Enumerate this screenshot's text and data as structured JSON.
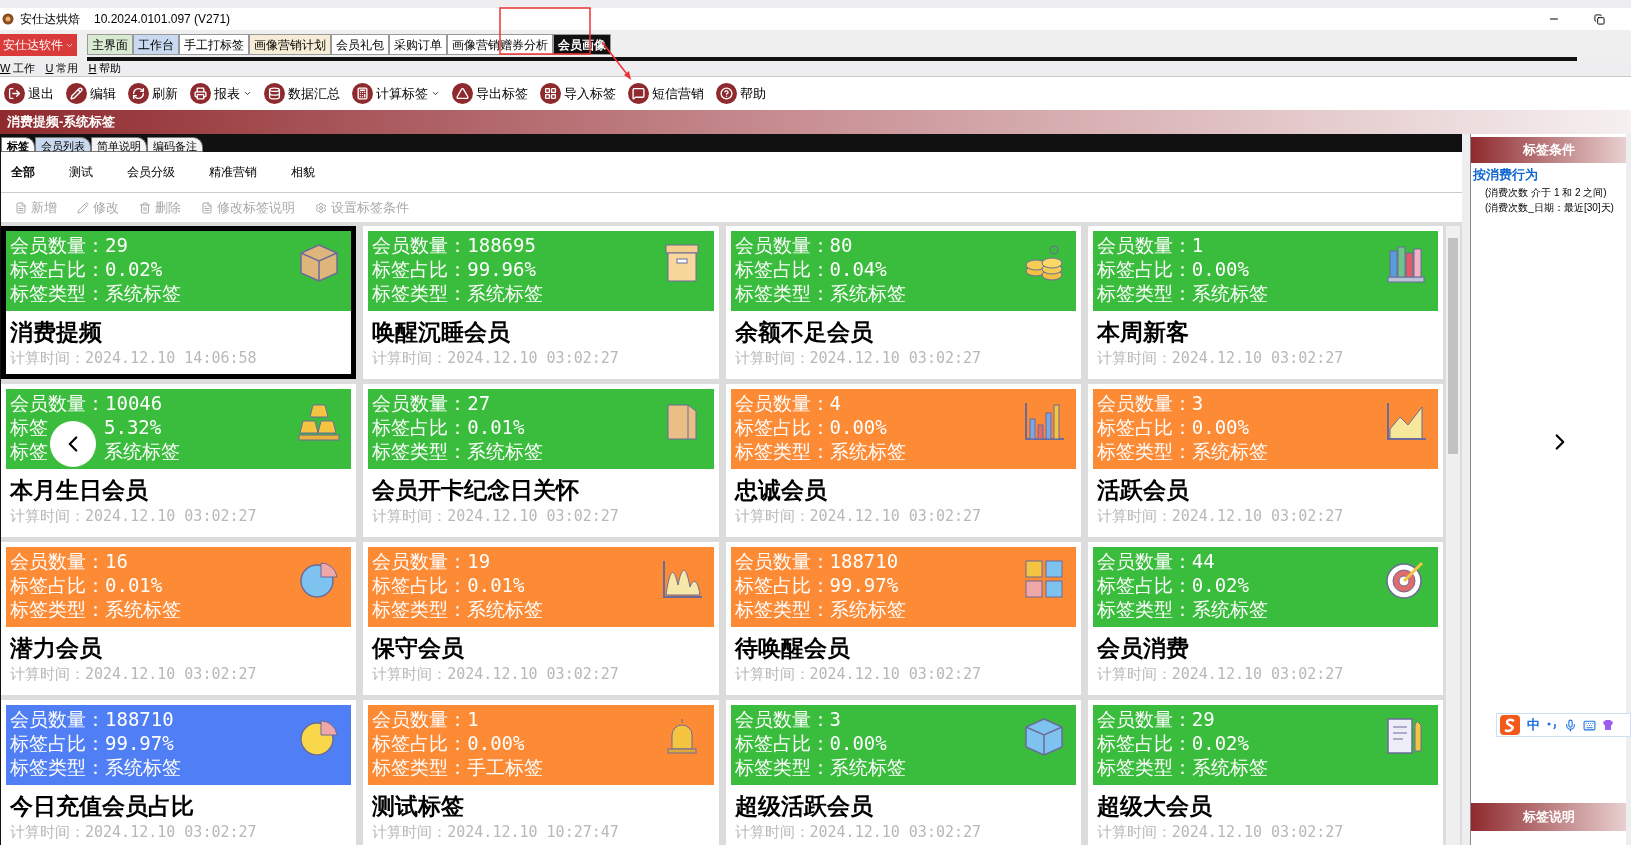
{
  "window": {
    "app_name": "安仕达烘焙",
    "version": "10.2024.0101.097 (V271)"
  },
  "brand_menu": "安仕达软件",
  "module_tabs": [
    {
      "label": "主界面",
      "selected": false,
      "color": "#d9ead3"
    },
    {
      "label": "工作台",
      "selected": false,
      "color": "#c9daf0"
    },
    {
      "label": "手工打标签",
      "selected": false,
      "color": "#ffffff"
    },
    {
      "label": "画像营销计划",
      "selected": false,
      "color": "#f7ecd5"
    },
    {
      "label": "会员礼包",
      "selected": false,
      "color": "#ffffff"
    },
    {
      "label": "采购订单",
      "selected": false,
      "color": "#ffffff"
    },
    {
      "label": "画像营销赠券分析",
      "selected": false,
      "color": "#ffffff"
    },
    {
      "label": "会员画像",
      "selected": true
    }
  ],
  "menu": [
    {
      "key": "W",
      "label": "工作"
    },
    {
      "key": "U",
      "label": "常用"
    },
    {
      "key": "H",
      "label": "帮助"
    }
  ],
  "toolbar": [
    {
      "label": "退出",
      "dropdown": false
    },
    {
      "label": "编辑",
      "dropdown": false
    },
    {
      "label": "刷新",
      "dropdown": false
    },
    {
      "label": "报表",
      "dropdown": true
    },
    {
      "label": "数据汇总",
      "dropdown": false
    },
    {
      "label": "计算标签",
      "dropdown": true
    },
    {
      "label": "导出标签",
      "dropdown": false
    },
    {
      "label": "导入标签",
      "dropdown": false
    },
    {
      "label": "短信营销",
      "dropdown": false
    },
    {
      "label": "帮助",
      "dropdown": false
    }
  ],
  "header": "消费提频-系统标签",
  "view_tabs": [
    {
      "label": "标签",
      "selected": true
    },
    {
      "label": "会员列表",
      "selected": false
    },
    {
      "label": "简单说明",
      "selected": false
    },
    {
      "label": "编码备注",
      "selected": false
    }
  ],
  "categories": [
    {
      "label": "全部",
      "selected": true
    },
    {
      "label": "测试",
      "selected": false
    },
    {
      "label": "会员分级",
      "selected": false
    },
    {
      "label": "精准营销",
      "selected": false
    },
    {
      "label": "相貌",
      "selected": false
    }
  ],
  "actions": [
    {
      "label": "新增",
      "disabled": true
    },
    {
      "label": "修改",
      "disabled": true
    },
    {
      "label": "删除",
      "disabled": true
    },
    {
      "label": "修改标签说明",
      "disabled": true
    },
    {
      "label": "设置标签条件",
      "disabled": true
    }
  ],
  "cards": [
    {
      "count": "会员数量：29",
      "ratio": "标签占比：0.02%",
      "type": "标签类型：系统标签",
      "title": "消费提频",
      "time": "计算时间：2024.12.10 14:06:58",
      "color": "#3abd3c",
      "selected": true
    },
    {
      "count": "会员数量：188695",
      "ratio": "标签占比：99.96%",
      "type": "标签类型：系统标签",
      "title": "唤醒沉睡会员",
      "time": "计算时间：2024.12.10 03:02:27",
      "color": "#3abd3c",
      "selected": false
    },
    {
      "count": "会员数量：80",
      "ratio": "标签占比：0.04%",
      "type": "标签类型：系统标签",
      "title": "余额不足会员",
      "time": "计算时间：2024.12.10 03:02:27",
      "color": "#3abd3c",
      "selected": false
    },
    {
      "count": "会员数量：1",
      "ratio": "标签占比：0.00%",
      "type": "标签类型：系统标签",
      "title": "本周新客",
      "time": "计算时间：2024.12.10 03:02:27",
      "color": "#3abd3c",
      "selected": false
    },
    {
      "count": "会员数量：10046",
      "ratio": "标签",
      "ratio_tail": "5.32%",
      "type": "标签",
      "type_tail": "系统标签",
      "title": "本月生日会员",
      "time": "计算时间：2024.12.10 03:02:27",
      "color": "#3abd3c",
      "selected": false
    },
    {
      "count": "会员数量：27",
      "ratio": "标签占比：0.01%",
      "type": "标签类型：系统标签",
      "title": "会员开卡纪念日关怀",
      "time": "计算时间：2024.12.10 03:02:27",
      "color": "#3abd3c",
      "selected": false
    },
    {
      "count": "会员数量：4",
      "ratio": "标签占比：0.00%",
      "type": "标签类型：系统标签",
      "title": "忠诚会员",
      "time": "计算时间：2024.12.10 03:02:27",
      "color": "#fd8a35",
      "selected": false
    },
    {
      "count": "会员数量：3",
      "ratio": "标签占比：0.00%",
      "type": "标签类型：系统标签",
      "title": "活跃会员",
      "time": "计算时间：2024.12.10 03:02:27",
      "color": "#fd8a35",
      "selected": false
    },
    {
      "count": "会员数量：16",
      "ratio": "标签占比：0.01%",
      "type": "标签类型：系统标签",
      "title": "潜力会员",
      "time": "计算时间：2024.12.10 03:02:27",
      "color": "#fd8a35",
      "selected": false
    },
    {
      "count": "会员数量：19",
      "ratio": "标签占比：0.01%",
      "type": "标签类型：系统标签",
      "title": "保守会员",
      "time": "计算时间：2024.12.10 03:02:27",
      "color": "#fd8a35",
      "selected": false
    },
    {
      "count": "会员数量：188710",
      "ratio": "标签占比：99.97%",
      "type": "标签类型：系统标签",
      "title": "待唤醒会员",
      "time": "计算时间：2024.12.10 03:02:27",
      "color": "#fd8a35",
      "selected": false
    },
    {
      "count": "会员数量：44",
      "ratio": "标签占比：0.02%",
      "type": "标签类型：系统标签",
      "title": "会员消费",
      "time": "计算时间：2024.12.10 03:02:27",
      "color": "#3abd3c",
      "selected": false
    },
    {
      "count": "会员数量：188710",
      "ratio": "标签占比：99.97%",
      "type": "标签类型：系统标签",
      "title": "今日充值会员占比",
      "time": "计算时间：2024.12.10 03:02:27",
      "color": "#507ef5",
      "selected": false
    },
    {
      "count": "会员数量：1",
      "ratio": "标签占比：0.00%",
      "type": "标签类型：手工标签",
      "title": "测试标签",
      "time": "计算时间：2024.12.10 10:27:47",
      "color": "#fd8a35",
      "selected": false
    },
    {
      "count": "会员数量：3",
      "ratio": "标签占比：0.00%",
      "type": "标签类型：系统标签",
      "title": "超级活跃会员",
      "time": "计算时间：2024.12.10 03:02:27",
      "color": "#3abd3c",
      "selected": false
    },
    {
      "count": "会员数量：29",
      "ratio": "标签占比：0.02%",
      "type": "标签类型：系统标签",
      "title": "超级大会员",
      "time": "计算时间：2024.12.10 03:02:27",
      "color": "#3abd3c",
      "selected": false
    }
  ],
  "conditions": {
    "title": "标签条件",
    "group": "按消费行为",
    "lines": [
      "(消费次数 介于 1 和 2 之间)",
      "(消费次数_日期：最近[30]天)"
    ]
  },
  "description": {
    "title": "标签说明"
  },
  "ime": {
    "mode": "中"
  }
}
